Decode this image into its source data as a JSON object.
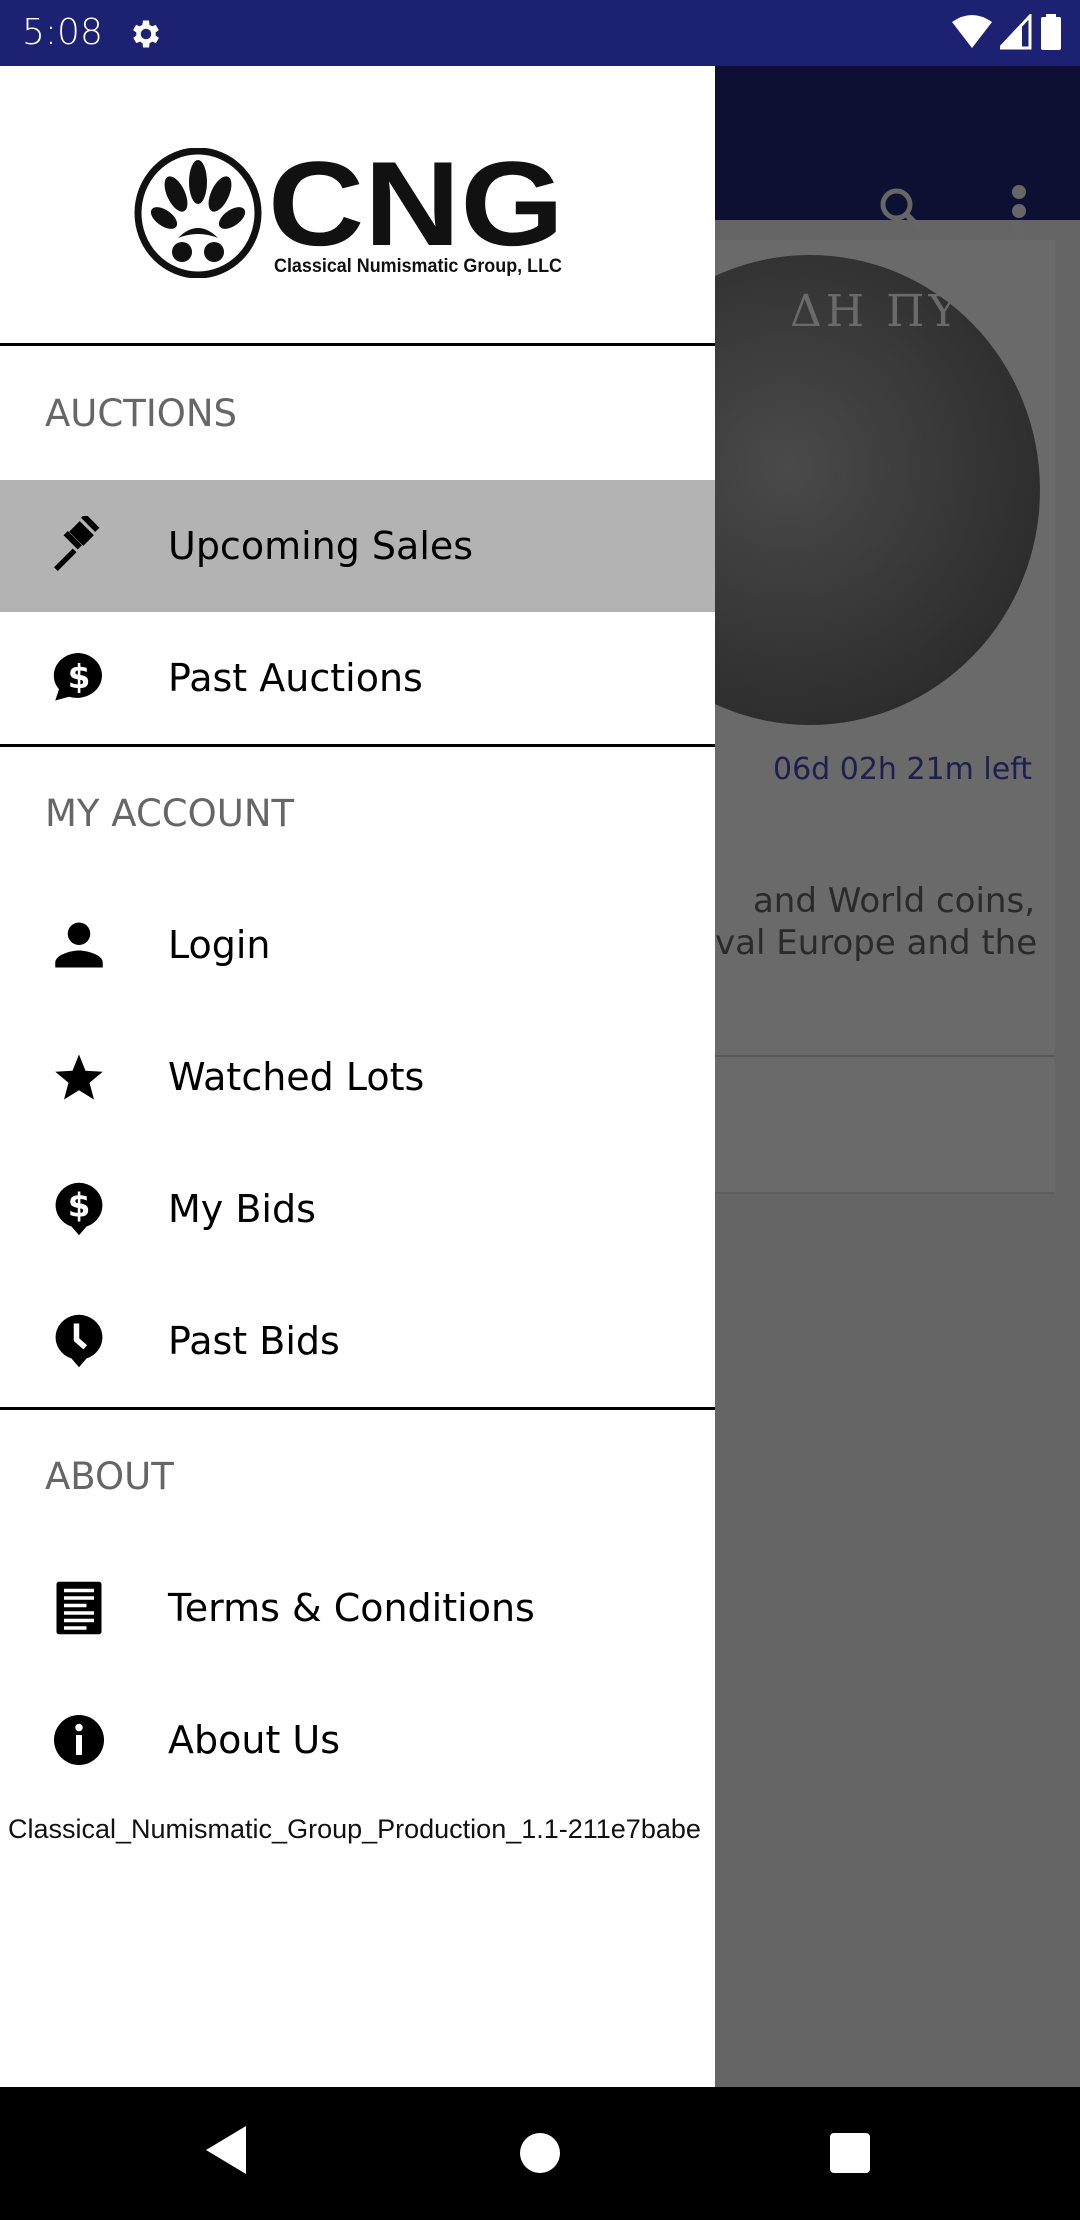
{
  "status_bar": {
    "time": "5:08",
    "icons": [
      "gear-icon",
      "wifi-icon",
      "signal-icon",
      "battery-icon"
    ]
  },
  "background": {
    "toolbar_icons": [
      "search-icon",
      "more-vert-icon"
    ],
    "coin_letters": "ΔΗ ΠΥ",
    "timer": "06d 02h 21m left",
    "description_lines": [
      "and World coins,",
      "val Europe and the"
    ]
  },
  "drawer": {
    "logo": {
      "brand": "CNG",
      "tagline": "Classical Numismatic Group, LLC"
    },
    "sections": [
      {
        "label": "AUCTIONS",
        "items": [
          {
            "label": "Upcoming Sales",
            "icon": "gavel-icon",
            "active": true
          },
          {
            "label": "Past Auctions",
            "icon": "dollar-chat-icon"
          }
        ]
      },
      {
        "label": "MY ACCOUNT",
        "items": [
          {
            "label": "Login",
            "icon": "person-icon"
          },
          {
            "label": "Watched Lots",
            "icon": "star-icon"
          },
          {
            "label": "My Bids",
            "icon": "dollar-pin-icon"
          },
          {
            "label": "Past Bids",
            "icon": "clock-pin-icon"
          }
        ]
      },
      {
        "label": "ABOUT",
        "items": [
          {
            "label": "Terms & Conditions",
            "icon": "document-icon"
          },
          {
            "label": "About Us",
            "icon": "info-icon"
          }
        ]
      }
    ],
    "version": "Classical_Numismatic_Group_Production_1.1-211e7babe"
  },
  "colors": {
    "status_bar": "#1c2172",
    "toolbar": "#0d1033",
    "active_item": "#b3b3b3",
    "scrim": "#656565"
  },
  "nav_bar": {
    "buttons": [
      "back-icon",
      "home-icon",
      "recents-icon"
    ]
  }
}
